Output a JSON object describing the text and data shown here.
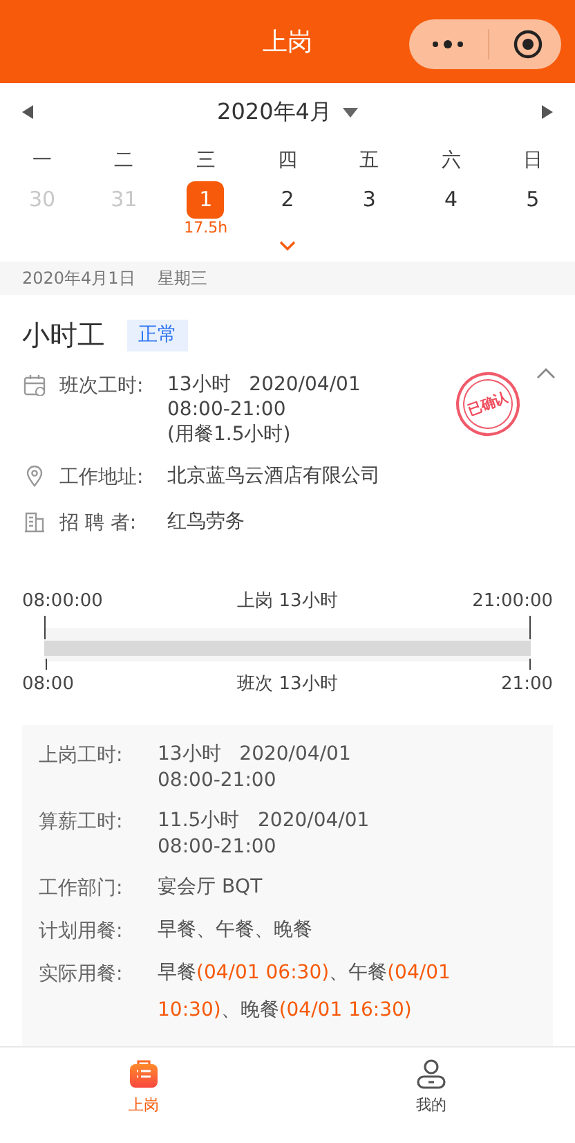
{
  "header": {
    "title": "上岗"
  },
  "calendar": {
    "month": "2020年4月",
    "weekdays": [
      "一",
      "二",
      "三",
      "四",
      "五",
      "六",
      "日"
    ],
    "days": [
      {
        "day": "30",
        "other_month": true,
        "selected": false
      },
      {
        "day": "31",
        "other_month": true,
        "selected": false
      },
      {
        "day": "1",
        "other_month": false,
        "selected": true,
        "hours": "17.5h"
      },
      {
        "day": "2",
        "other_month": false,
        "selected": false
      },
      {
        "day": "3",
        "other_month": false,
        "selected": false
      },
      {
        "day": "4",
        "other_month": false,
        "selected": false
      },
      {
        "day": "5",
        "other_month": false,
        "selected": false
      }
    ]
  },
  "date_bar": {
    "date": "2020年4月1日",
    "weekday": "星期三"
  },
  "shift": {
    "title": "小时工",
    "status": "正常",
    "stamp": "已确认",
    "expanded": true,
    "info": [
      {
        "kind": "schedule",
        "label": "班次工时:",
        "lines": [
          "13小时   2020/04/01",
          "08:00-21:00",
          "(用餐1.5小时)"
        ]
      },
      {
        "kind": "location",
        "label": "工作地址:",
        "lines": [
          "北京蓝鸟云酒店有限公司"
        ]
      },
      {
        "kind": "employer",
        "label": "招 聘 者:",
        "lines": [
          "红鸟劳务"
        ]
      }
    ]
  },
  "timeline": {
    "top_start": "08:00:00",
    "top_label": "上岗 13小时",
    "top_end": "21:00:00",
    "bottom_start": "08:00",
    "bottom_label": "班次 13小时",
    "bottom_end": "21:00"
  },
  "details": [
    {
      "label": "上岗工时:",
      "lines": [
        "13小时   2020/04/01",
        "08:00-21:00"
      ]
    },
    {
      "label": "算薪工时:",
      "lines": [
        "11.5小时   2020/04/01",
        "08:00-21:00"
      ]
    },
    {
      "label": "工作部门:",
      "lines": [
        "宴会厅 BQT"
      ]
    },
    {
      "label": "计划用餐:",
      "lines": [
        "早餐、午餐、晚餐"
      ]
    },
    {
      "label": "实际用餐:",
      "parts": [
        {
          "kind": "plain",
          "text": "早餐"
        },
        {
          "kind": "time",
          "text": "(04/01 06:30)"
        },
        {
          "kind": "plain",
          "text": "、午餐"
        },
        {
          "kind": "time",
          "text": "(04/01 10:30)"
        },
        {
          "kind": "plain",
          "text": "、晚餐"
        },
        {
          "kind": "time",
          "text": "(04/01 16:30)"
        }
      ]
    }
  ],
  "tabbar": [
    {
      "kind": "work",
      "label": "上岗",
      "selected": true
    },
    {
      "kind": "me",
      "label": "我的",
      "selected": false
    }
  ]
}
